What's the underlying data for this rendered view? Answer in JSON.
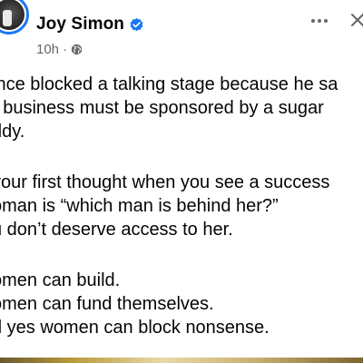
{
  "post": {
    "author": "Joy Simon",
    "time": "10h",
    "lines": [
      "ince blocked a talking stage because he sa",
      "r business must be sponsored by a sugar",
      "ddy.",
      "your first thought when you see a success",
      "oman is “which man is behind her?”",
      "u don’t deserve access to her.",
      "omen can build.",
      "omen can fund themselves.",
      "d yes women can block nonsense."
    ]
  },
  "icons": {
    "verified": "verified-badge-icon",
    "privacy": "globe-icon",
    "more": "more-options-icon",
    "close": "close-icon"
  },
  "colors": {
    "verified": "#1877f2",
    "secondary_text": "#65676b",
    "primary_text": "#050505"
  }
}
